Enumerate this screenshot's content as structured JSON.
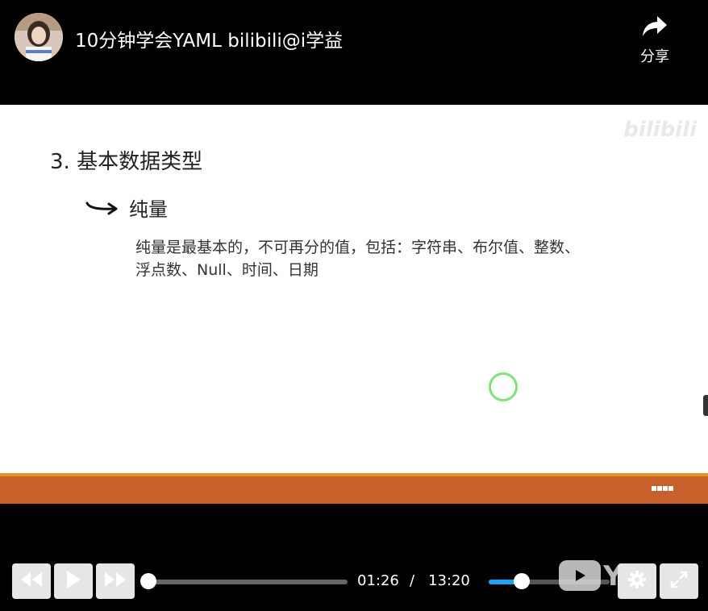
{
  "header": {
    "title": "10分钟学会YAML bilibili@i学益",
    "share_label": "分享"
  },
  "slide": {
    "watermark": "bilibili",
    "heading": "3. 基本数据类型",
    "subheading": "纯量",
    "body_lines": [
      "纯量是最基本的，不可再分的值，包括：字符串、布尔值、整数、",
      "浮点数、Null、时间、日期"
    ]
  },
  "player": {
    "current_time": "01:26",
    "separator": "/",
    "total_time": "13:20",
    "progress_fraction": 0.11,
    "volume_fraction": 0.27,
    "accent_color": "#1aa4f5",
    "icons": [
      "rewind-icon",
      "play-icon",
      "fast-forward-icon",
      "settings-icon",
      "fullscreen-icon"
    ]
  },
  "colors": {
    "slide_band": "#c8602b",
    "slide_band_line": "#e9922a",
    "cursor_ring": "#7fe07f"
  }
}
